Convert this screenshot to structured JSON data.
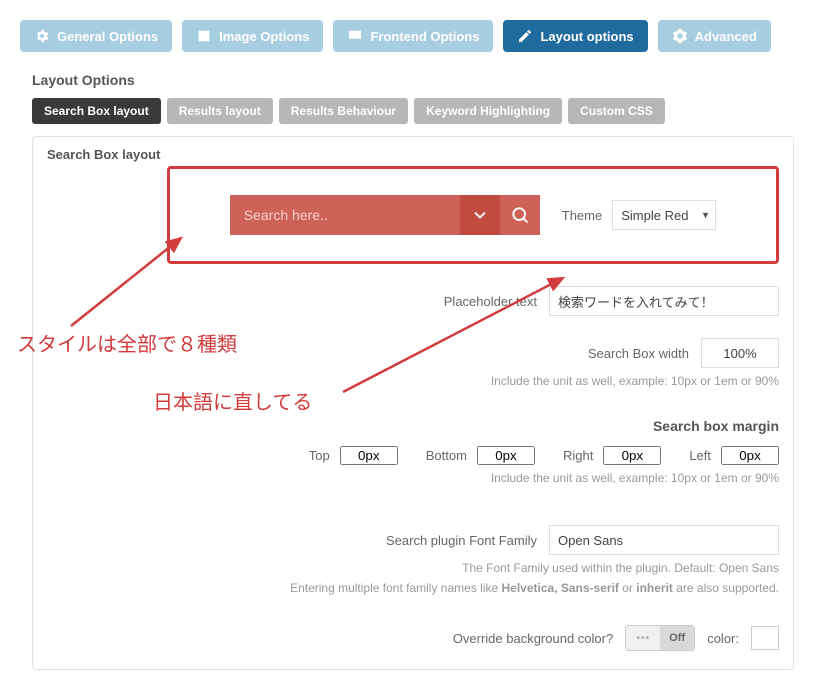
{
  "mainTabs": {
    "general": "General Options",
    "image": "Image Options",
    "frontend": "Frontend Options",
    "layout": "Layout options",
    "advanced": "Advanced"
  },
  "sectionTitle": "Layout Options",
  "subTabs": {
    "sbl": "Search Box layout",
    "rl": "Results layout",
    "rb": "Results Behaviour",
    "kh": "Keyword Highlighting",
    "cc": "Custom CSS"
  },
  "fieldsetLegend": "Search Box layout",
  "preview": {
    "placeholder": "Search here..",
    "themeLabel": "Theme",
    "themeValue": "Simple Red"
  },
  "rows": {
    "placeholder": {
      "label": "Placeholder text",
      "value": "検索ワードを入れてみて！"
    },
    "width": {
      "label": "Search Box width",
      "value": "100%"
    },
    "hintUnit": "Include the unit as well, example: 10px or 1em or 90%",
    "marginHead": "Search box margin",
    "margin": {
      "topL": "Top",
      "topV": "0px",
      "bottomL": "Bottom",
      "bottomV": "0px",
      "rightL": "Right",
      "rightV": "0px",
      "leftL": "Left",
      "leftV": "0px"
    },
    "fontFamily": {
      "label": "Search plugin Font Family",
      "value": "Open Sans"
    },
    "fontHint1": "The Font Family used within the plugin. Default: Open Sans",
    "fontHint2a": "Entering multiple font family names like ",
    "fontHint2b": "Helvetica, Sans-serif",
    "fontHint2c": " or ",
    "fontHint2d": "inherit",
    "fontHint2e": " are also supported.",
    "override": {
      "label": "Override background color?",
      "off": "Off",
      "on": "•••",
      "colorLabel": "color:"
    }
  },
  "annotations": {
    "a1": "スタイルは全部で８種類",
    "a2": "日本語に直してる"
  }
}
